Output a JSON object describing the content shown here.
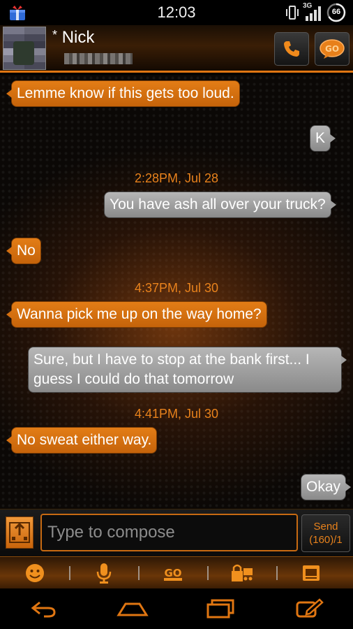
{
  "status_bar": {
    "time": "12:03",
    "network": "3G",
    "battery": "66"
  },
  "header": {
    "contact_name": "Nick",
    "name_prefix": "*"
  },
  "messages": [
    {
      "kind": "in",
      "text": "Lemme know if this gets too loud."
    },
    {
      "kind": "out",
      "text": "K"
    },
    {
      "kind": "time",
      "text": "2:28PM, Jul 28"
    },
    {
      "kind": "out",
      "text": "You have ash all over your truck?"
    },
    {
      "kind": "in",
      "text": "No"
    },
    {
      "kind": "time",
      "text": "4:37PM, Jul 30"
    },
    {
      "kind": "in",
      "text": "Wanna pick me up on the way home?"
    },
    {
      "kind": "out",
      "text": "Sure, but I have to stop at the bank first... I guess I could do that tomorrow"
    },
    {
      "kind": "time",
      "text": "4:41PM, Jul 30"
    },
    {
      "kind": "in",
      "text": "No sweat either way."
    },
    {
      "kind": "out",
      "text": "Okay"
    }
  ],
  "compose": {
    "placeholder": "Type to compose",
    "send_label": "Send",
    "counter": "(160)/1"
  },
  "icons": {
    "toolbar": [
      "smiley-icon",
      "microphone-icon",
      "go-icon",
      "lock-cart-icon",
      "card-icon"
    ],
    "nav": [
      "back-icon",
      "home-icon",
      "recent-apps-icon",
      "edit-icon"
    ]
  },
  "colors": {
    "accent": "#e07612",
    "incoming_bubble": "#d46f10",
    "outgoing_bubble": "#9e9e9e"
  }
}
